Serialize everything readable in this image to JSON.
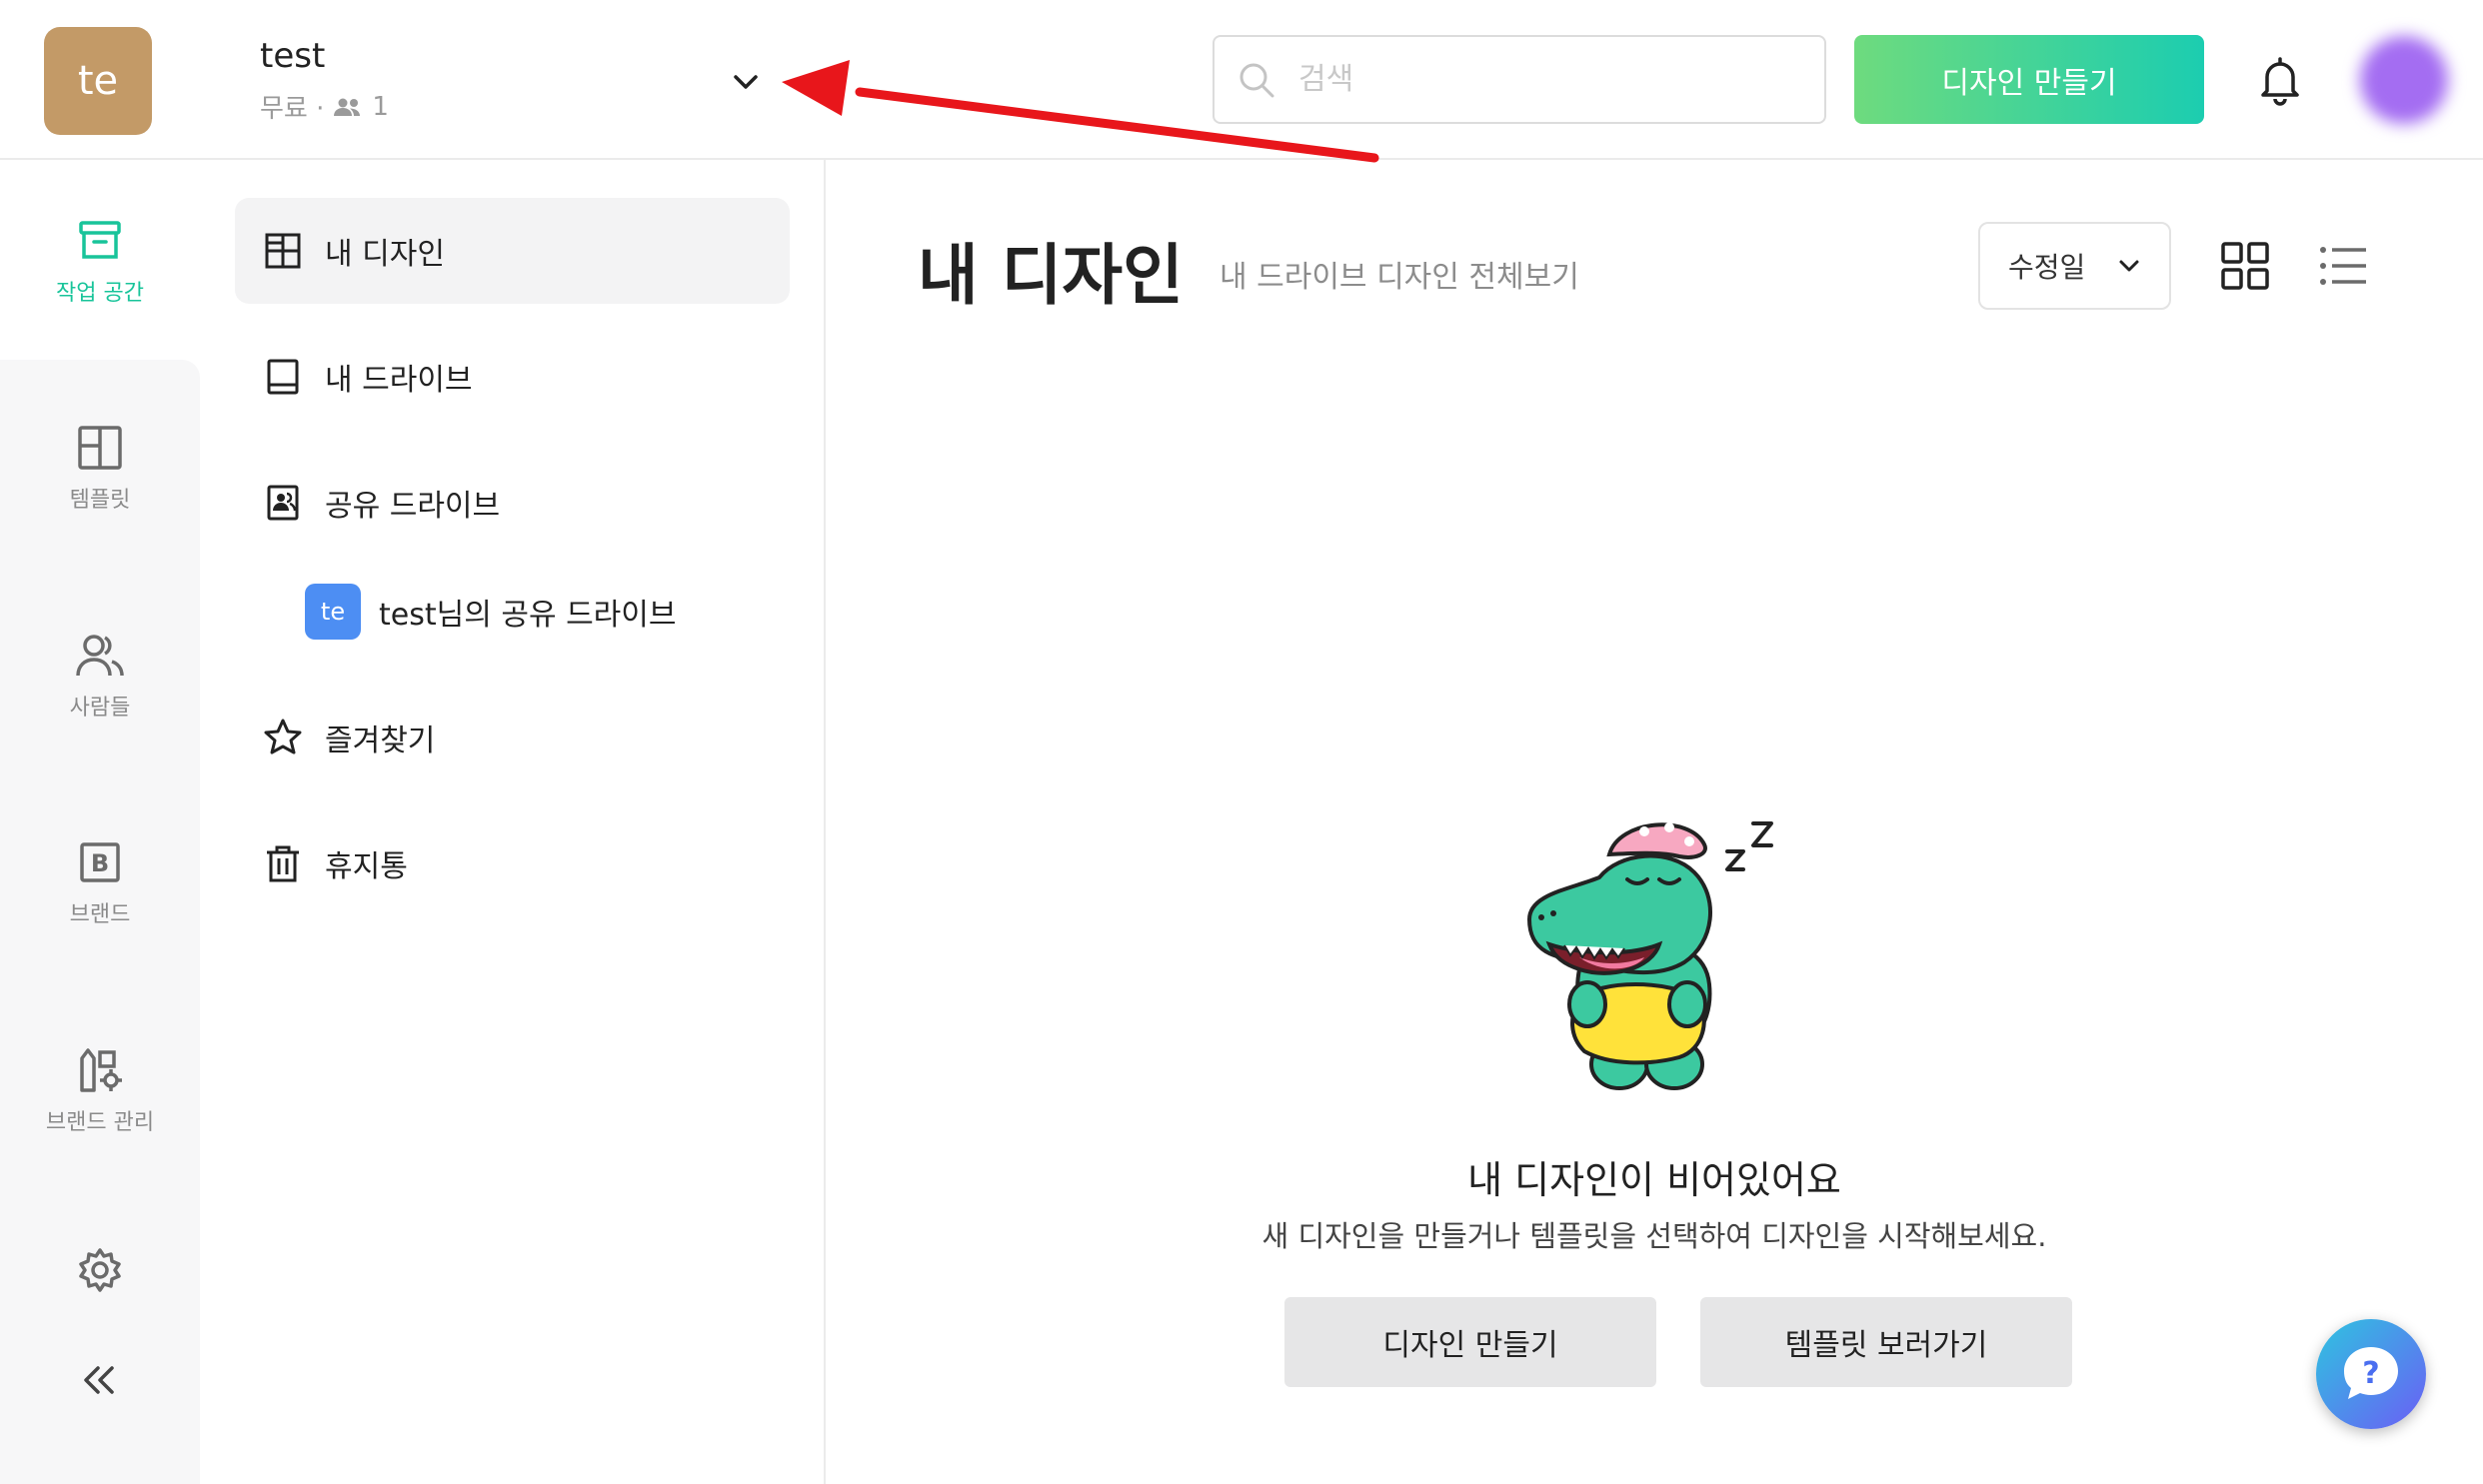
{
  "header": {
    "workspace_initials": "te",
    "workspace_name": "test",
    "plan_label": "무료 ·",
    "member_count": "1",
    "search_placeholder": "검색",
    "create_button_label": "디자인 만들기"
  },
  "rail": {
    "items": [
      {
        "label": "작업 공간",
        "icon": "archive-icon",
        "active": true
      },
      {
        "label": "템플릿",
        "icon": "layout-icon"
      },
      {
        "label": "사람들",
        "icon": "people-icon"
      },
      {
        "label": "브랜드",
        "icon": "brand-b-icon"
      },
      {
        "label": "브랜드 관리",
        "icon": "brand-manage-icon"
      }
    ]
  },
  "sidebar": {
    "items": [
      {
        "label": "내 디자인",
        "icon": "grid-layout-icon",
        "active": true
      },
      {
        "label": "내 드라이브",
        "icon": "drive-icon"
      },
      {
        "label": "공유 드라이브",
        "icon": "shared-drive-icon"
      },
      {
        "label": "즐겨찾기",
        "icon": "star-icon"
      },
      {
        "label": "휴지통",
        "icon": "trash-icon"
      }
    ],
    "shared_sub": {
      "badge": "te",
      "label": "test님의 공유 드라이브"
    }
  },
  "main": {
    "title": "내 디자인",
    "subtitle": "내 드라이브 디자인 전체보기",
    "sort_label": "수정일",
    "empty_title": "내 디자인이 비어있어요",
    "empty_desc": "새 디자인을 만들거나 템플릿을 선택하여 디자인을 시작해보세요.",
    "create_label": "디자인 만들기",
    "templates_label": "템플릿 보러가기"
  },
  "colors": {
    "accent": "#18c49a",
    "workspace_avatar": "#c39a67",
    "shared_badge": "#4d8ef3",
    "annotation_arrow": "#e8161b"
  }
}
